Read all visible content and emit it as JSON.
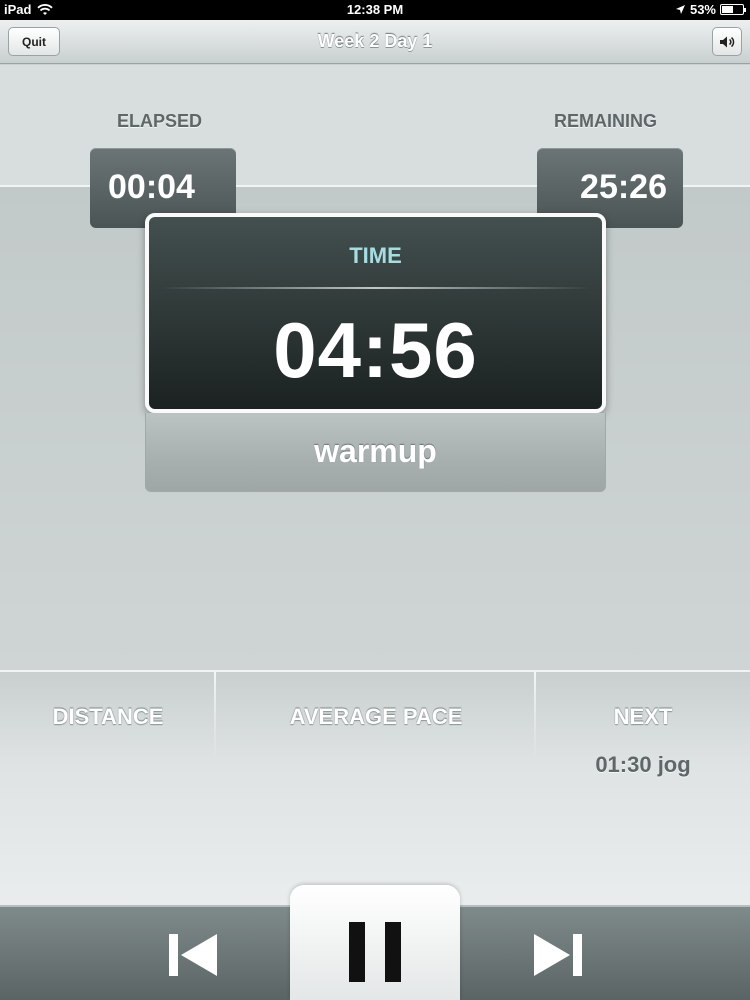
{
  "status_bar": {
    "device": "iPad",
    "time": "12:38 PM",
    "battery": "53%",
    "battery_level": 0.53
  },
  "nav": {
    "title": "Week 2  Day 1",
    "quit_label": "Quit",
    "sound_icon": "speaker-icon"
  },
  "elapsed": {
    "label": "ELAPSED",
    "value": "00:04"
  },
  "remaining": {
    "label": "REMAINING",
    "value": "25:26"
  },
  "timer": {
    "label": "TIME",
    "value": "04:56",
    "phase": "warmup"
  },
  "metrics": {
    "distance_label": "DISTANCE",
    "pace_label": "AVERAGE PACE",
    "next_label": "NEXT",
    "next_value": "01:30 jog"
  },
  "toolbar": {
    "prev_icon": "skip-previous-icon",
    "pause_icon": "pause-icon",
    "next_icon": "skip-next-icon"
  },
  "colors": {
    "timer_label": "#a6dde2",
    "bubble": "#5a6464"
  }
}
